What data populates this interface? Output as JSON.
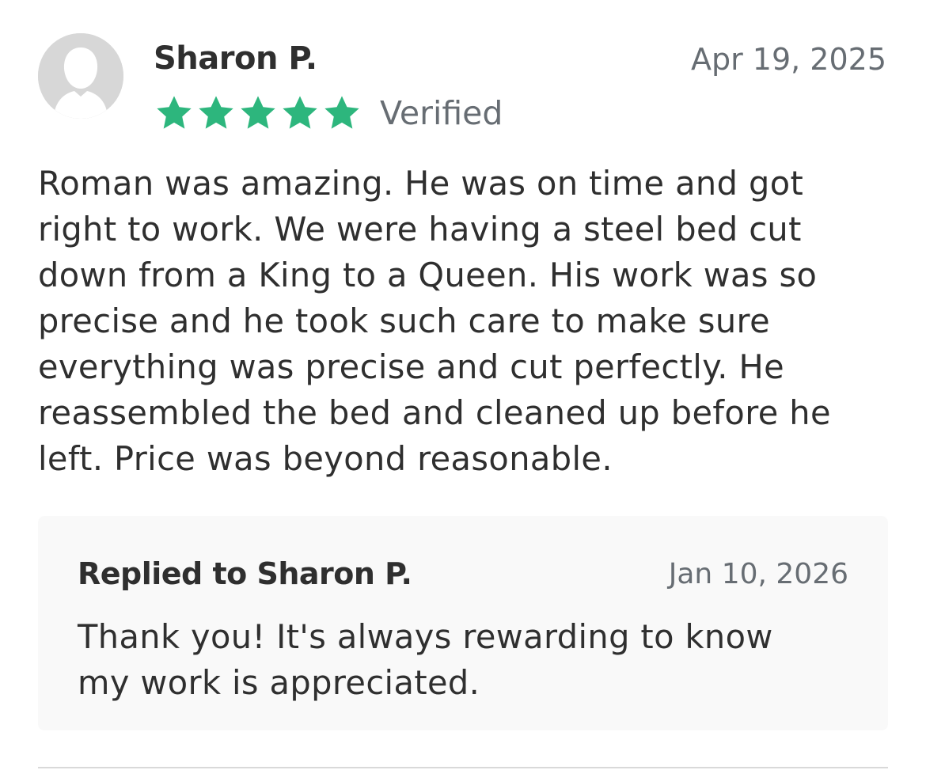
{
  "review": {
    "reviewer_name": "Sharon P.",
    "date": "Apr 19, 2025",
    "rating": 5,
    "rating_max": 5,
    "star_color": "#2db67d",
    "verified_label": "Verified",
    "text": "Roman was amazing. He was on time and got\nright to work. We were having a steel bed cut\ndown from a King to a Queen.  His work was so\nprecise and he took such care to make sure\neverything was precise and cut perfectly. He\nreassembled the bed and cleaned up before he\nleft. Price was beyond reasonable."
  },
  "reply": {
    "title": "Replied to Sharon P.",
    "date": "Jan 10, 2026",
    "text": "Thank you! It's always rewarding to know\nmy work is appreciated."
  },
  "icons": {
    "avatar": "default-user-avatar-icon",
    "star": "star-icon"
  }
}
